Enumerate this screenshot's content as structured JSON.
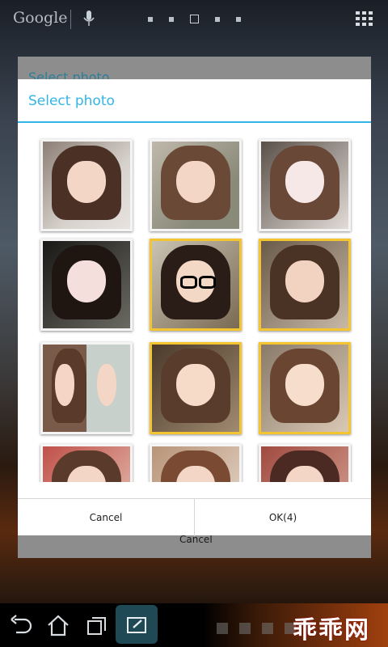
{
  "home": {
    "search_label": "Google"
  },
  "background_dialog": {
    "title": "Select photo",
    "cancel_label": "Cancel"
  },
  "dialog": {
    "title": "Select photo",
    "cancel_label": "Cancel",
    "ok_label": "OK(4)",
    "accent_color": "#33b5e5",
    "selection_color": "#f4c531",
    "photos": [
      {
        "selected": false
      },
      {
        "selected": false
      },
      {
        "selected": false
      },
      {
        "selected": false
      },
      {
        "selected": true
      },
      {
        "selected": true
      },
      {
        "selected": false
      },
      {
        "selected": true
      },
      {
        "selected": true
      },
      {
        "selected": false
      },
      {
        "selected": false
      },
      {
        "selected": false
      }
    ]
  },
  "navbar": {
    "buttons": [
      "back-icon",
      "home-icon",
      "recent-apps-icon",
      "screenshot-icon"
    ],
    "status_icons": [
      "android-debug-icon",
      "usb-icon",
      "gmail-icon",
      "signal-icon"
    ]
  },
  "watermark": "乖乖网"
}
